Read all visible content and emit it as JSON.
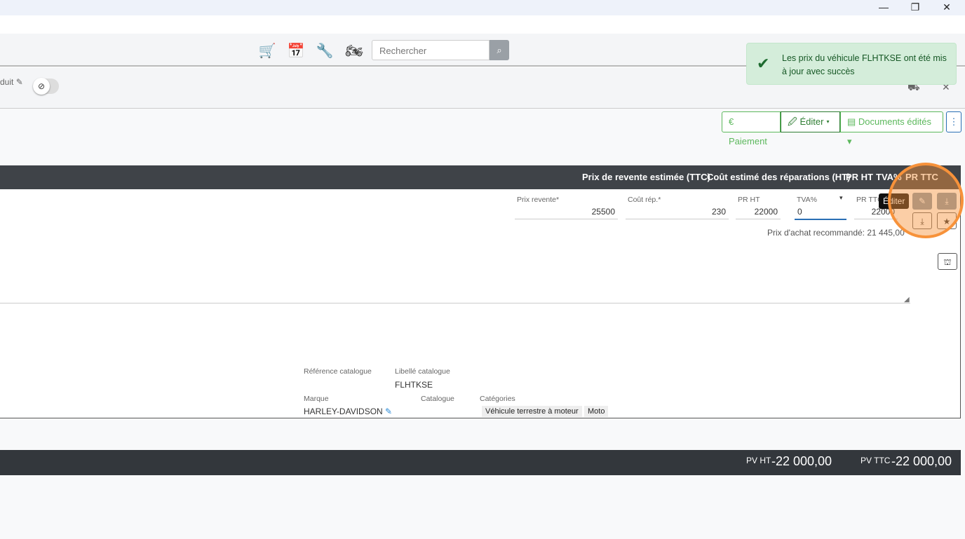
{
  "window": {
    "minimize": "—",
    "restore": "❐",
    "close": "✕"
  },
  "header": {
    "search_placeholder": "Rechercher"
  },
  "subheader": {
    "product_label": "duit"
  },
  "toast": {
    "message": "Les prix du véhicule FLHTKSE ont été mis à jour avec succès"
  },
  "toolbar": {
    "payment": "€ Paiement",
    "edit": "Éditer",
    "documents": "Documents édités"
  },
  "table": {
    "headers": [
      "Prix de revente estimée (TTC)",
      "Coût estimé des réparations (HT)",
      "PR HT",
      "TVA%",
      "PR TTC"
    ]
  },
  "prices": {
    "resale_label": "Prix revente*",
    "resale_value": "25500",
    "repair_label": "Coût rép.*",
    "repair_value": "230",
    "prht_label": "PR HT",
    "prht_value": "22000",
    "tva_label": "TVA%",
    "tva_value": "0",
    "prttc_label": "PR TTC",
    "prttc_value": "22000",
    "recommended": "Prix d'achat recommandé: 21 445,00",
    "tooltip": "Éditer"
  },
  "catalog": {
    "ref_label": "Référence catalogue",
    "libelle_label": "Libellé catalogue",
    "libelle_value": "FLHTKSE",
    "brand_label": "Marque",
    "brand_value": "HARLEY-DAVIDSON",
    "catalog_label": "Catalogue",
    "categories_label": "Catégories",
    "categories": [
      "Véhicule terrestre à moteur",
      "Moto"
    ]
  },
  "footer": {
    "pvht_label": "PV HT",
    "pvht_value": "-22 000,00",
    "pvttc_label": "PV TTC",
    "pvttc_value": "-22 000,00"
  },
  "colors": {
    "accent": "#5cb85c",
    "highlight": "#f7923a"
  }
}
